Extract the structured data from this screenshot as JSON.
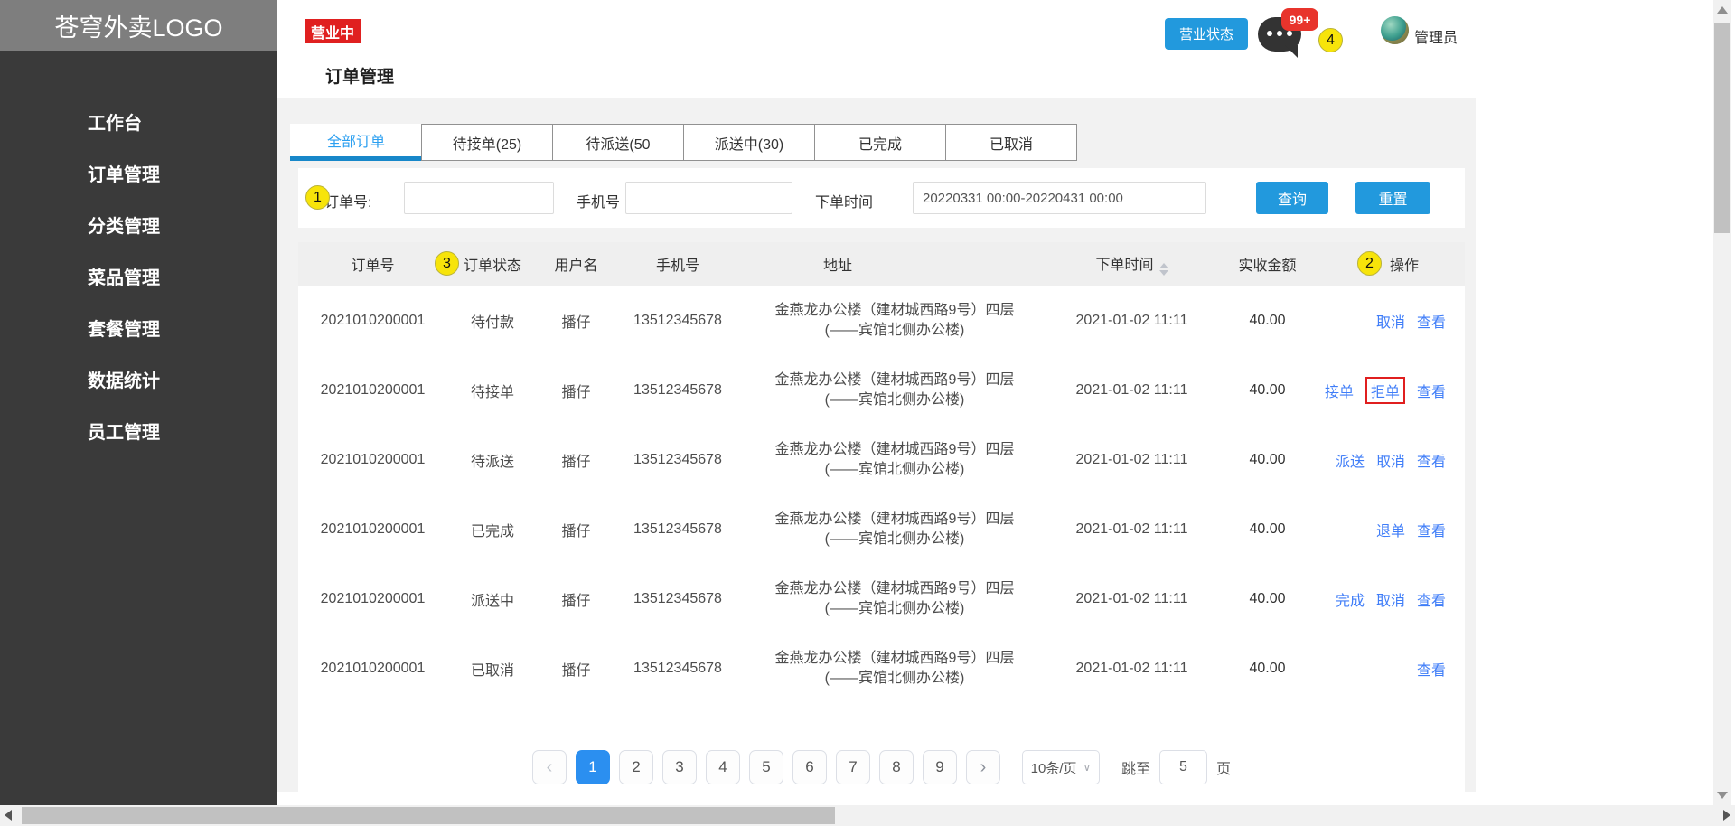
{
  "app": {
    "logo_text": "苍穹外卖LOGO"
  },
  "sidebar": {
    "items": [
      {
        "name": "workbench",
        "label": "工作台"
      },
      {
        "name": "order-management",
        "label": "订单管理"
      },
      {
        "name": "category-management",
        "label": "分类管理"
      },
      {
        "name": "dish-management",
        "label": "菜品管理"
      },
      {
        "name": "setmeal-management",
        "label": "套餐管理"
      },
      {
        "name": "statistics",
        "label": "数据统计"
      },
      {
        "name": "employee-management",
        "label": "员工管理"
      }
    ]
  },
  "header": {
    "business_badge": "营业中",
    "page_title": "订单管理",
    "business_status_button": "营业状态",
    "notification_count": "99+",
    "user_name": "管理员"
  },
  "annotations": {
    "marker1": "1",
    "marker2": "2",
    "marker3": "3",
    "marker4": "4"
  },
  "tabs": [
    {
      "name": "all-orders",
      "label": "全部订单",
      "active": true
    },
    {
      "name": "pending-accept",
      "label": "待接单(25)",
      "active": false
    },
    {
      "name": "pending-delivery",
      "label": "待派送(50",
      "active": false
    },
    {
      "name": "delivering",
      "label": "派送中(30)",
      "active": false
    },
    {
      "name": "completed",
      "label": "已完成",
      "active": false
    },
    {
      "name": "cancelled",
      "label": "已取消",
      "active": false
    }
  ],
  "filters": {
    "order_no_label": "订单号:",
    "phone_label": "手机号",
    "time_label": "下单时间",
    "time_value": "20220331 00:00-20220431 00:00",
    "search_button": "查询",
    "reset_button": "重置"
  },
  "table": {
    "columns": [
      {
        "name": "order-no",
        "label": "订单号"
      },
      {
        "name": "order-status",
        "label": "订单状态"
      },
      {
        "name": "user-name",
        "label": "用户名"
      },
      {
        "name": "phone",
        "label": "手机号"
      },
      {
        "name": "address",
        "label": "地址"
      },
      {
        "name": "order-time",
        "label": "下单时间",
        "sortable": true
      },
      {
        "name": "amount",
        "label": "实收金额"
      },
      {
        "name": "operations",
        "label": "操作"
      }
    ],
    "rows": [
      {
        "order_no": "2021010200001",
        "status": "待付款",
        "user": "播仔",
        "phone": "13512345678",
        "address_line1": "金燕龙办公楼（建材城西路9号）四层",
        "address_line2": "(——宾馆北侧办公楼)",
        "time": "2021-01-02 11:11",
        "amount": "40.00",
        "actions": [
          {
            "name": "cancel",
            "label": "取消"
          },
          {
            "name": "view",
            "label": "查看"
          }
        ]
      },
      {
        "order_no": "2021010200001",
        "status": "待接单",
        "user": "播仔",
        "phone": "13512345678",
        "address_line1": "金燕龙办公楼（建材城西路9号）四层",
        "address_line2": "(——宾馆北侧办公楼)",
        "time": "2021-01-02 11:11",
        "amount": "40.00",
        "actions": [
          {
            "name": "accept",
            "label": "接单"
          },
          {
            "name": "reject",
            "label": "拒单",
            "boxed": true
          },
          {
            "name": "view",
            "label": "查看"
          }
        ]
      },
      {
        "order_no": "2021010200001",
        "status": "待派送",
        "user": "播仔",
        "phone": "13512345678",
        "address_line1": "金燕龙办公楼（建材城西路9号）四层",
        "address_line2": "(——宾馆北侧办公楼)",
        "time": "2021-01-02 11:11",
        "amount": "40.00",
        "actions": [
          {
            "name": "deliver",
            "label": "派送"
          },
          {
            "name": "cancel",
            "label": "取消"
          },
          {
            "name": "view",
            "label": "查看"
          }
        ]
      },
      {
        "order_no": "2021010200001",
        "status": "已完成",
        "user": "播仔",
        "phone": "13512345678",
        "address_line1": "金燕龙办公楼（建材城西路9号）四层",
        "address_line2": "(——宾馆北侧办公楼)",
        "time": "2021-01-02 11:11",
        "amount": "40.00",
        "actions": [
          {
            "name": "refund",
            "label": "退单"
          },
          {
            "name": "view",
            "label": "查看"
          }
        ]
      },
      {
        "order_no": "2021010200001",
        "status": "派送中",
        "user": "播仔",
        "phone": "13512345678",
        "address_line1": "金燕龙办公楼（建材城西路9号）四层",
        "address_line2": "(——宾馆北侧办公楼)",
        "time": "2021-01-02 11:11",
        "amount": "40.00",
        "actions": [
          {
            "name": "complete",
            "label": "完成"
          },
          {
            "name": "cancel",
            "label": "取消"
          },
          {
            "name": "view",
            "label": "查看"
          }
        ]
      },
      {
        "order_no": "2021010200001",
        "status": "已取消",
        "user": "播仔",
        "phone": "13512345678",
        "address_line1": "金燕龙办公楼（建材城西路9号）四层",
        "address_line2": "(——宾馆北侧办公楼)",
        "time": "2021-01-02 11:11",
        "amount": "40.00",
        "actions": [
          {
            "name": "view",
            "label": "查看"
          }
        ]
      }
    ]
  },
  "pagination": {
    "prev": "‹",
    "next": "›",
    "pages": [
      "1",
      "2",
      "3",
      "4",
      "5",
      "6",
      "7",
      "8",
      "9"
    ],
    "active_page": "1",
    "page_size": "10条/页",
    "jump_label": "跳至",
    "jump_value": "5",
    "page_unit": "页"
  },
  "colors": {
    "accent_blue": "#2b9ff0",
    "button_blue": "#2299dd",
    "link_blue": "#3f7df8",
    "badge_red": "#e02020",
    "marker_yellow": "#f7e40a",
    "sidebar_dark": "#3a3a3a",
    "logo_gray": "#7e7e7e"
  }
}
